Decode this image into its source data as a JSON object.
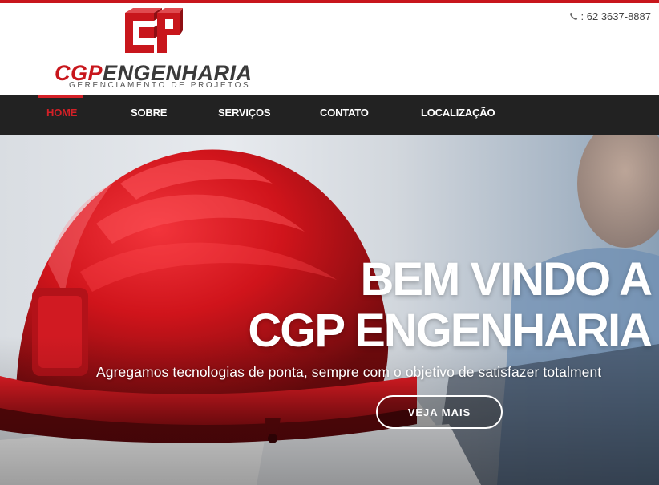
{
  "header": {
    "logo": {
      "name_part1": "CGP",
      "name_part2": "ENGENHARIA",
      "tagline": "GERENCIAMENTO DE PROJETOS"
    },
    "phone": ": 62 3637-8887",
    "phone_icon": "phone-icon"
  },
  "nav": {
    "items": [
      {
        "label": "HOME",
        "active": true
      },
      {
        "label": "SOBRE",
        "active": false
      },
      {
        "label": "SERVIÇOS",
        "active": false
      },
      {
        "label": "CONTATO",
        "active": false
      },
      {
        "label": "LOCALIZAÇÃO",
        "active": false
      }
    ]
  },
  "hero": {
    "title_line1": "BEM VINDO A",
    "title_line2": "CGP ENGENHARIA",
    "subtitle": "Agregamos tecnologias de ponta, sempre com o objetivo de satisfazer totalment",
    "button_label": "VEJA MAIS"
  },
  "colors": {
    "brand_red": "#c8161c",
    "nav_bg": "#222222",
    "nav_active": "#d32027"
  }
}
